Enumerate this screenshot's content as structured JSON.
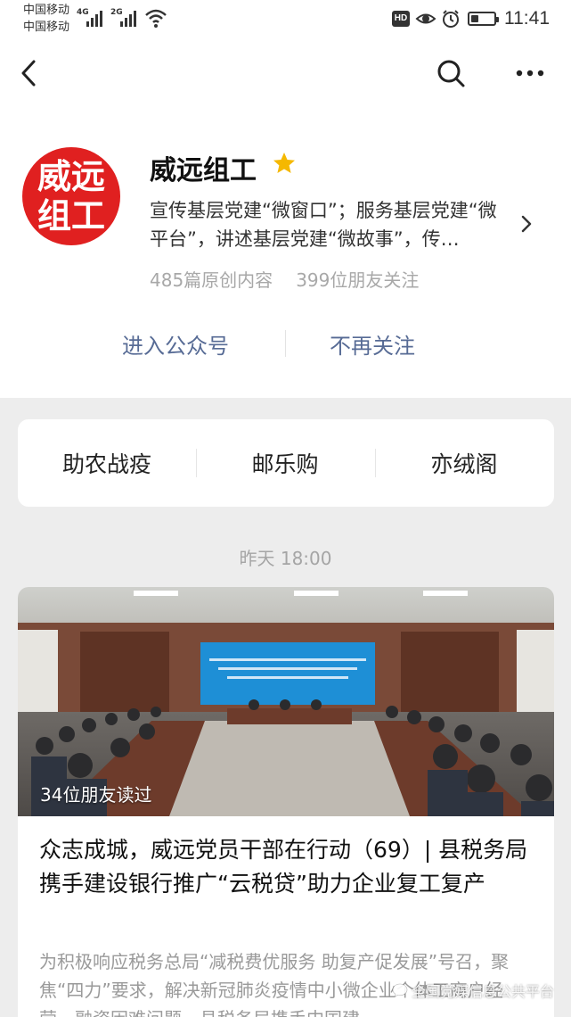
{
  "status_bar": {
    "carrier_1": "中国移动",
    "carrier_2": "中国移动",
    "net_1": "4G",
    "net_2": "2G",
    "hd": "HD",
    "battery_level": 0.35,
    "time": "11:41"
  },
  "nav": {
    "back_icon": "back-arrow-icon",
    "search_icon": "search-icon",
    "more_icon": "more-icon"
  },
  "account": {
    "avatar_line1": "威远",
    "avatar_line2": "组工",
    "name": "威远组工",
    "star_color": "#f5b800",
    "description": "宣传基层党建“微窗口”；服务基层党建“微平台”，讲述基层党建“微故事”，传…",
    "original_count": "485篇原创内容",
    "followers": "399位朋友关注"
  },
  "actions": {
    "enter": "进入公众号",
    "unfollow": "不再关注"
  },
  "menu": [
    "助农战疫",
    "邮乐购",
    "亦绒阁"
  ],
  "feed": {
    "timestamp": "昨天 18:00",
    "article": {
      "readers": "34位朋友读过",
      "title": "众志成城，威远党员干部在行动（69）| 县税务局携手建设银行推广“云税贷”助力企业复工复产",
      "digest": "为积极响应税务总局“减税费优服务 助复产促发展”号召，聚焦“四力”要求，解决新冠肺炎疫情中小微企业个体工商户经营、融资困难问题，县税务局携手中国建"
    }
  },
  "watermark": "全国党媒信息公共平台",
  "colors": {
    "link": "#576b95",
    "avatar_bg": "#e02020"
  }
}
